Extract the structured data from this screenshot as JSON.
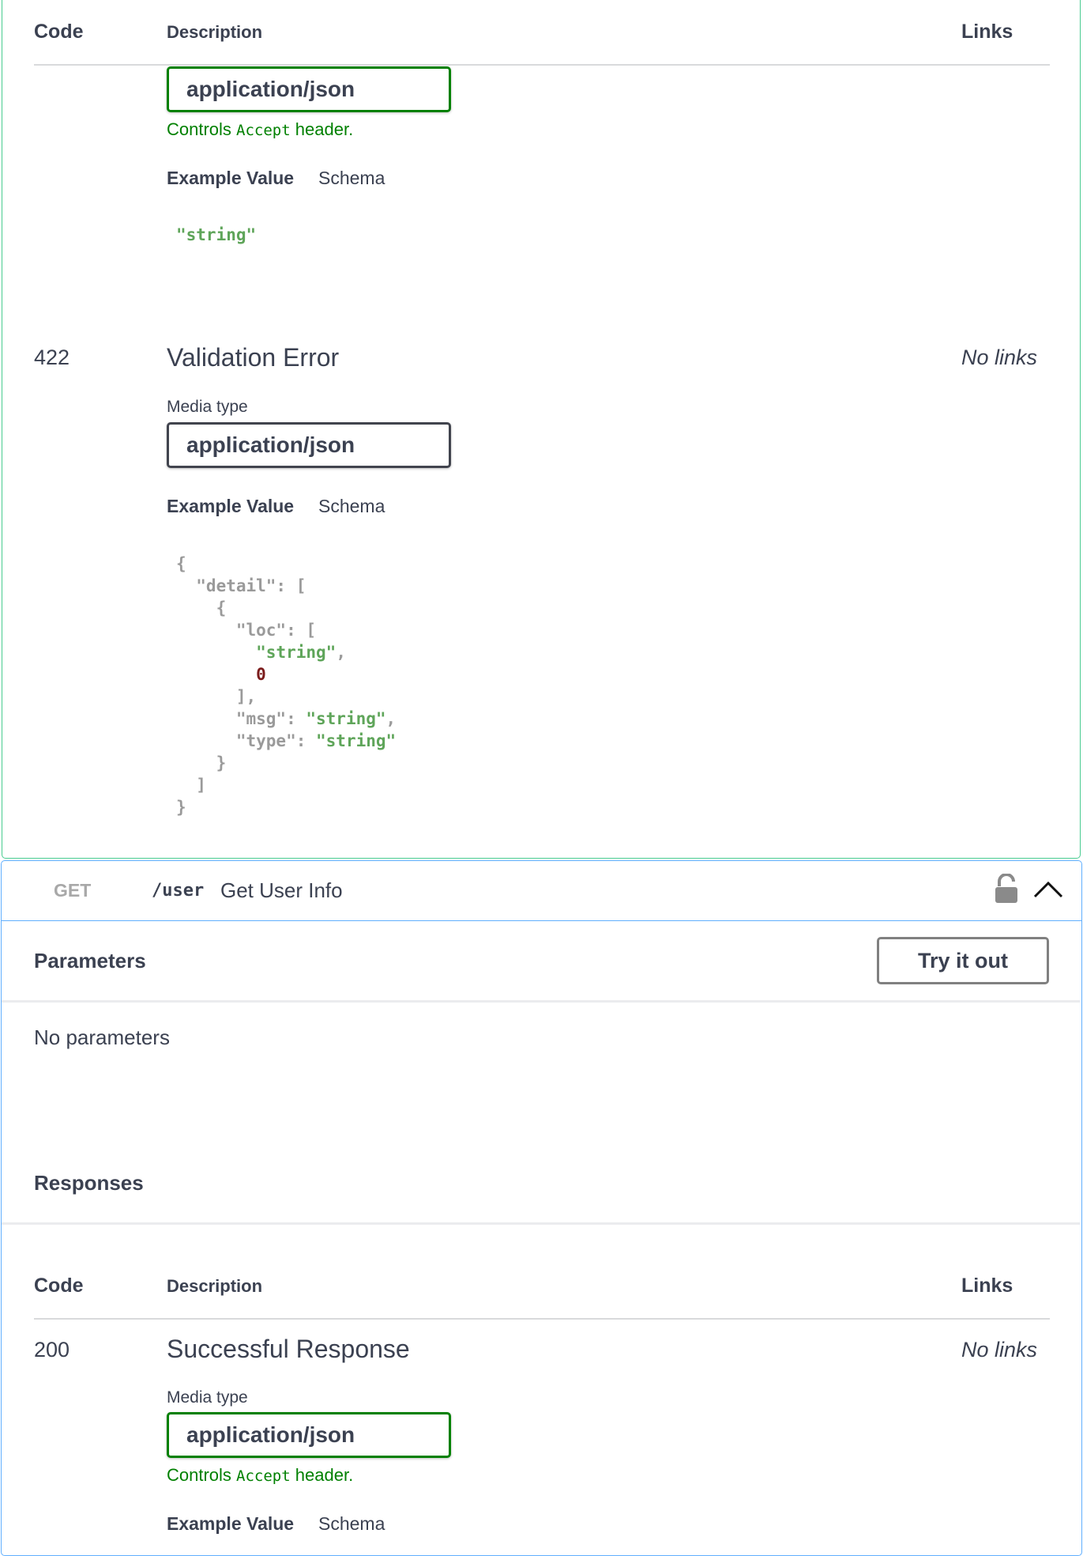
{
  "post_op": {
    "table_header": {
      "code": "Code",
      "description": "Description",
      "links": "Links"
    },
    "response_200_tail": {
      "media_type_value": "application/json",
      "controls_prefix": "Controls ",
      "controls_code": "Accept",
      "controls_suffix": " header.",
      "example_value_tab": "Example Value",
      "schema_tab": "Schema",
      "example_json": "\"string\""
    },
    "response_422": {
      "code": "422",
      "description": "Validation Error",
      "links": "No links",
      "media_type_label": "Media type",
      "media_type_value": "application/json",
      "example_value_tab": "Example Value",
      "schema_tab": "Schema"
    }
  },
  "get_op": {
    "method": "GET",
    "path": "/user",
    "summary": "Get User Info",
    "lock_icon": "lock-open-icon",
    "collapse_icon": "chevron-up-icon",
    "parameters_title": "Parameters",
    "try_it_out": "Try it out",
    "no_parameters": "No parameters",
    "responses_title": "Responses",
    "table_header": {
      "code": "Code",
      "description": "Description",
      "links": "Links"
    },
    "response_200": {
      "code": "200",
      "description": "Successful Response",
      "links": "No links",
      "media_type_label": "Media type",
      "media_type_value": "application/json",
      "controls_prefix": "Controls ",
      "controls_code": "Accept",
      "controls_suffix": " header.",
      "example_value_tab": "Example Value",
      "schema_tab": "Schema"
    }
  },
  "colors": {
    "post_border": "#49cc90",
    "get_border": "#61affe",
    "select_green": "#008000",
    "text": "#3b4151"
  }
}
